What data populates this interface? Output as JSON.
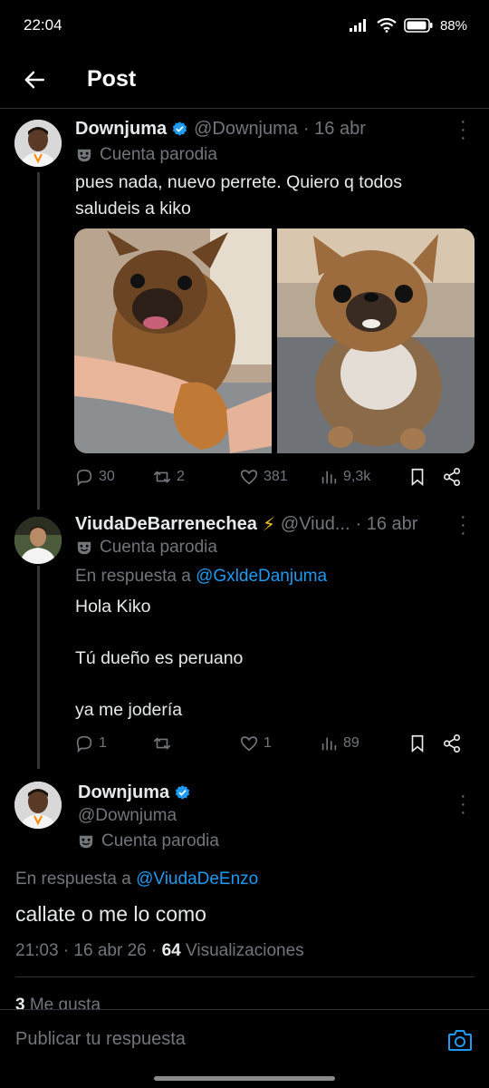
{
  "status_bar": {
    "time": "22:04",
    "battery": "88%"
  },
  "header": {
    "title": "Post"
  },
  "tweets": [
    {
      "name": "Downjuma",
      "handle": "@Downjuma",
      "date": "· 16 abr",
      "parody_label": "Cuenta parodia",
      "text_lines": [
        "pues nada, nuevo perrete. Quiero q todos",
        "saludeis a kiko"
      ],
      "actions": {
        "replies": "30",
        "retweets": "2",
        "likes": "381",
        "views": "9,3k"
      }
    },
    {
      "name": "ViudaDeBarrenechea",
      "emoji": "⚡",
      "handle": "@Viud...",
      "date": "· 16 abr",
      "parody_label": "Cuenta parodia",
      "reply_prefix": "En respuesta a",
      "reply_mention": "@GxldeDanjuma",
      "text_lines": [
        "Hola Kiko",
        "",
        "Tú dueño es peruano",
        "",
        "ya me jodería"
      ],
      "actions": {
        "replies": "1",
        "retweets": "",
        "likes": "1",
        "views": "89"
      }
    }
  ],
  "main_tweet": {
    "name": "Downjuma",
    "handle": "@Downjuma",
    "parody_label": "Cuenta parodia",
    "reply_prefix": "En respuesta a",
    "reply_mention": "@ViudaDeEnzo",
    "text": "callate o me lo como",
    "time": "21:03 · 16 abr 26 ·",
    "views_count": "64",
    "views_label": "Visualizaciones",
    "likes_count": "3",
    "likes_label": "Me gusta"
  },
  "reply_bar": {
    "placeholder": "Publicar tu respuesta"
  },
  "colors": {
    "accent": "#1d9bf0",
    "muted": "#71767b",
    "background": "#000000"
  }
}
